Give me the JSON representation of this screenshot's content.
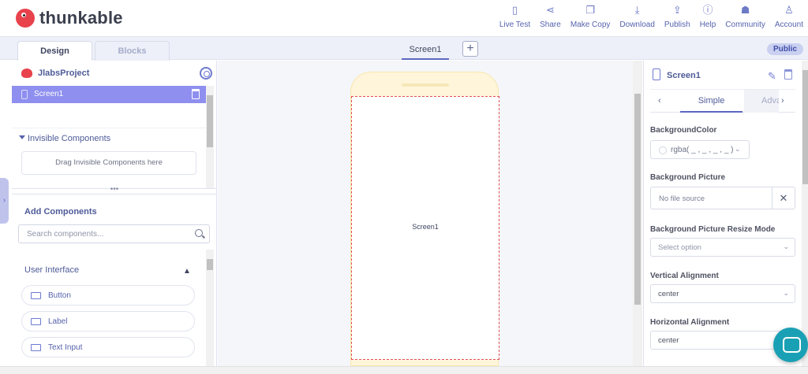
{
  "app": {
    "brand": "thunkable"
  },
  "topnav": [
    {
      "label": "Live Test",
      "icon": "phone-icon",
      "glyph": "▯"
    },
    {
      "label": "Share",
      "icon": "share-icon",
      "glyph": "⋖"
    },
    {
      "label": "Make Copy",
      "icon": "copy-icon",
      "glyph": "❐"
    },
    {
      "label": "Download",
      "icon": "download-icon",
      "glyph": "⤓"
    },
    {
      "label": "Publish",
      "icon": "publish-icon",
      "glyph": "⇪"
    },
    {
      "label": "Help",
      "icon": "help-icon",
      "glyph": "ⓘ"
    },
    {
      "label": "Community",
      "icon": "community-icon",
      "glyph": "☗"
    },
    {
      "label": "Account",
      "icon": "account-icon",
      "glyph": "♙"
    }
  ],
  "subbar": {
    "design_tab": "Design",
    "blocks_tab": "Blocks",
    "screen_tab": "Screen1",
    "add_screen": "+",
    "public_badge": "Public"
  },
  "left": {
    "project_name": "JlabsProject",
    "screen_item": "Screen1",
    "invisible_header": "Invisible Components",
    "drop_zone": "Drag Invisible Components here",
    "splitter": "•••",
    "add_components": "Add Components",
    "search_placeholder": "Search components...",
    "ui_section": "User Interface",
    "ui_chevron": "▲",
    "components": [
      {
        "label": "Button",
        "icon": "button-icon"
      },
      {
        "label": "Label",
        "icon": "label-icon"
      },
      {
        "label": "Text Input",
        "icon": "text-input-icon"
      }
    ]
  },
  "canvas": {
    "screen_label": "Screen1"
  },
  "right": {
    "title": "Screen1",
    "edit": "✎",
    "tab_prev": "‹",
    "tab_simple": "Simple",
    "tab_advanced": "Advanced",
    "tab_next": "›",
    "bg_color_label": "BackgroundColor",
    "bg_color_value": "rgba( _ , _ , _ , _ )",
    "bg_picture_label": "Background Picture",
    "bg_picture_value": "No file source",
    "bg_picture_clear": "✕",
    "resize_label": "Background Picture Resize Mode",
    "resize_placeholder": "Select option",
    "valign_label": "Vertical Alignment",
    "valign_value": "center",
    "halign_label": "Horizontal Alignment",
    "halign_value": "center",
    "caret": "⌄"
  },
  "left_toggle": "›",
  "colors": {
    "accent": "#5b67c2",
    "selected_row": "#8f8ff0",
    "brand_red": "#e8424c",
    "chat": "#1aa0b4",
    "phone_frame": "#fff5da"
  }
}
